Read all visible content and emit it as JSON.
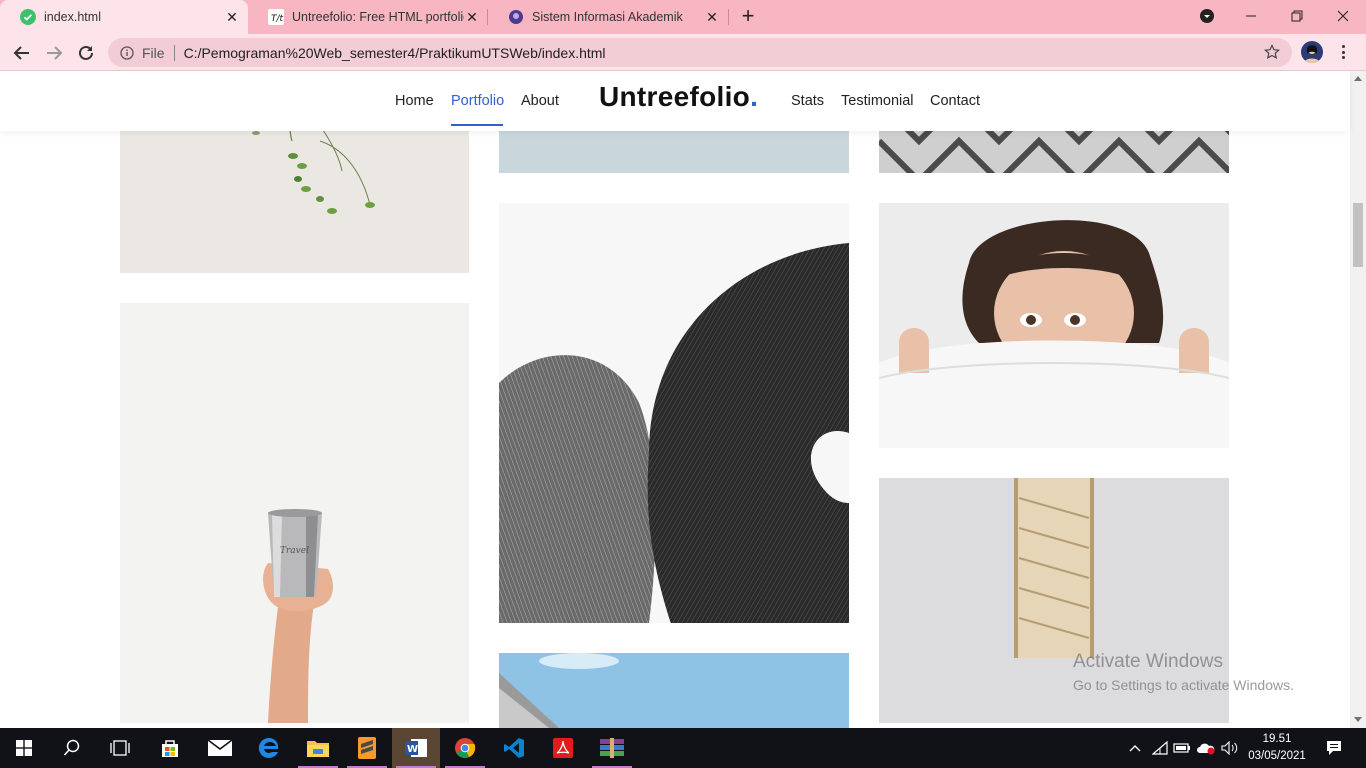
{
  "browser": {
    "tabs": [
      {
        "title": "index.html",
        "active": true
      },
      {
        "title": "Untreefolio: Free HTML portfolio",
        "active": false
      },
      {
        "title": "Sistem Informasi Akademik",
        "active": false
      }
    ],
    "address": {
      "scheme_label": "File",
      "url": "C:/Pemograman%20Web_semester4/PraktikumUTSWeb/index.html"
    }
  },
  "site": {
    "nav_left": [
      "Home",
      "Portfolio",
      "About"
    ],
    "nav_right": [
      "Stats",
      "Testimonial",
      "Contact"
    ],
    "active_nav": "Portfolio",
    "logo": "Untreefolio",
    "logo_dot": ".",
    "accent_color": "#2f5fd0"
  },
  "watermark": {
    "title": "Activate Windows",
    "subtitle": "Go to Settings to activate Windows."
  },
  "taskbar": {
    "time": "19.51",
    "date": "03/05/2021"
  },
  "colors": {
    "tabstrip": "#f7b6c2",
    "toolbar": "#fde4ea",
    "taskbar": "#101217"
  }
}
